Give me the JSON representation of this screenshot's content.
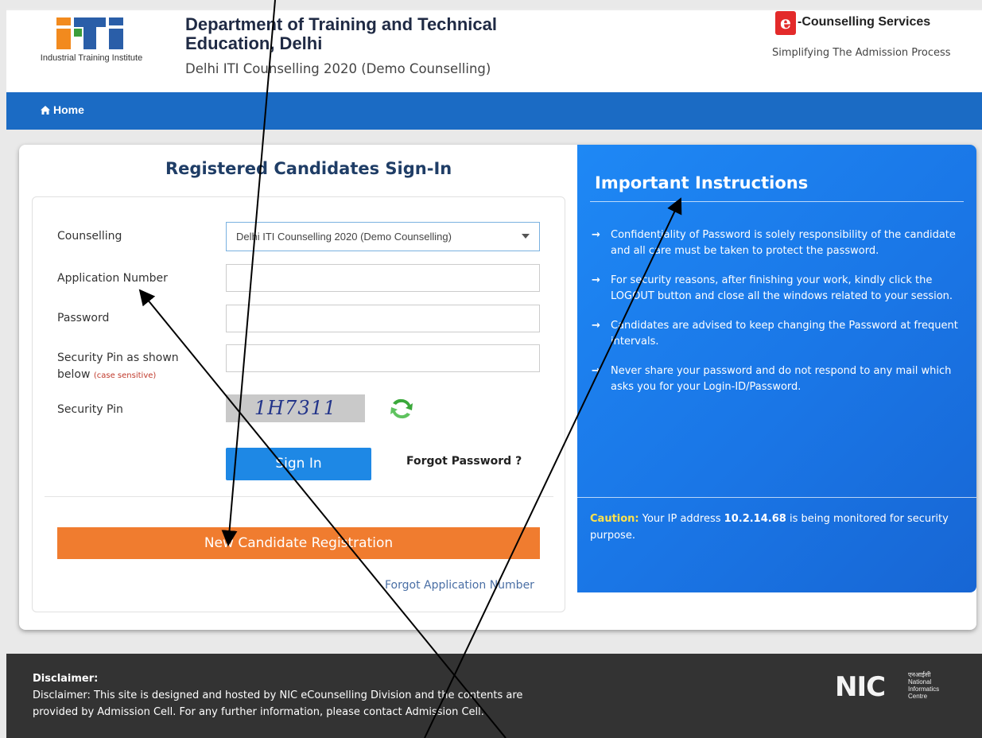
{
  "header": {
    "iti_caption": "Industrial Training Institute",
    "dept_title": "Department of Training and Technical Education, Delhi",
    "dept_subtitle": "Delhi ITI Counselling 2020 (Demo Counselling)",
    "ec_name": "-Counselling Services",
    "ec_tagline": "Simplifying The Admission Process"
  },
  "nav": {
    "home_label": "Home"
  },
  "signin": {
    "title": "Registered Candidates Sign-In",
    "counselling_label": "Counselling",
    "counselling_value": "Delhi ITI Counselling 2020 (Demo Counselling)",
    "app_number_label": "Application Number",
    "password_label": "Password",
    "security_pin_label": "Security Pin as shown below",
    "case_note": "(case sensitive)",
    "captcha_label": "Security Pin",
    "captcha_text": "1H7311",
    "signin_button": "Sign In",
    "forgot_password": "Forgot Password ?",
    "new_registration": "New Candidate Registration",
    "forgot_app_number": "Forgot Application Number"
  },
  "instructions": {
    "title": "Important Instructions",
    "items": [
      "Confidentiality of Password is solely responsibility of the candidate and all care must be taken to protect the password.",
      "For security reasons, after finishing your work, kindly click the LOGOUT button and close all the windows related to your session.",
      "Candidates are advised to keep changing the Password at frequent intervals.",
      "Never share your password and do not respond to any mail which asks you for your Login-ID/Password."
    ],
    "caution_label": "Caution:",
    "caution_prefix": "Your IP address",
    "caution_ip": "10.2.14.68",
    "caution_suffix": "is being monitored for security purpose."
  },
  "footer": {
    "disclaimer_title": "Disclaimer:",
    "disclaimer_text": "Disclaimer: This site is designed and hosted by NIC eCounselling Division and the contents are provided by Admission Cell. For any further information, please contact Admission Cell.",
    "nic_mark": "NIC",
    "nic_hindi": "एनआईसी",
    "nic_line1": "National",
    "nic_line2": "Informatics",
    "nic_line3": "Centre"
  },
  "colors": {
    "nav_blue": "#1b6bc4",
    "primary_button": "#1e88e5",
    "registration_button": "#f07c2f",
    "instruction_panel": "#1a76e6",
    "caution_yellow": "#ffe24a",
    "footer_bg": "#333333"
  }
}
